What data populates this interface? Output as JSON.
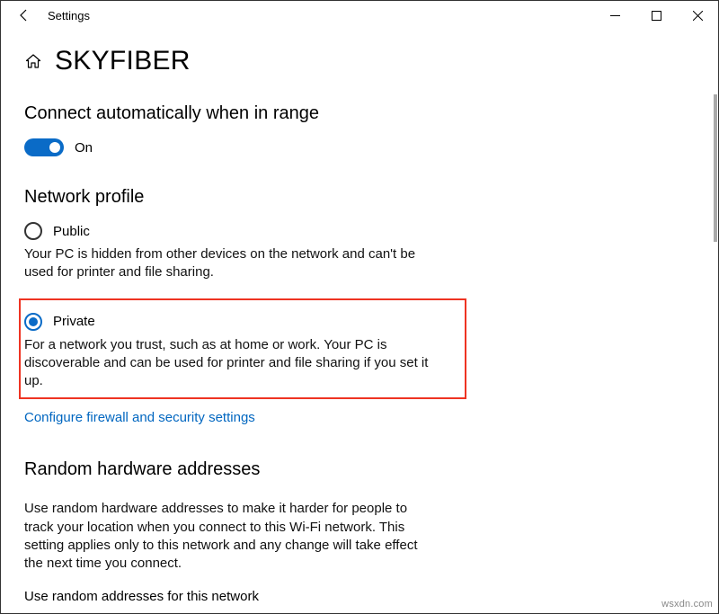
{
  "window": {
    "title": "Settings"
  },
  "page": {
    "network_name": "SKYFIBER",
    "auto_connect_heading": "Connect automatically when in range",
    "toggle_on_label": "On",
    "network_profile_heading": "Network profile",
    "public": {
      "label": "Public",
      "desc": "Your PC is hidden from other devices on the network and can't be used for printer and file sharing."
    },
    "private": {
      "label": "Private",
      "desc": "For a network you trust, such as at home or work. Your PC is discoverable and can be used for printer and file sharing if you set it up."
    },
    "firewall_link": "Configure firewall and security settings",
    "random_hw_heading": "Random hardware addresses",
    "random_hw_desc": "Use random hardware addresses to make it harder for people to track your location when you connect to this Wi-Fi network. This setting applies only to this network and any change will take effect the next time you connect.",
    "random_addr_label": "Use random addresses for this network"
  },
  "watermark": "wsxdn.com"
}
